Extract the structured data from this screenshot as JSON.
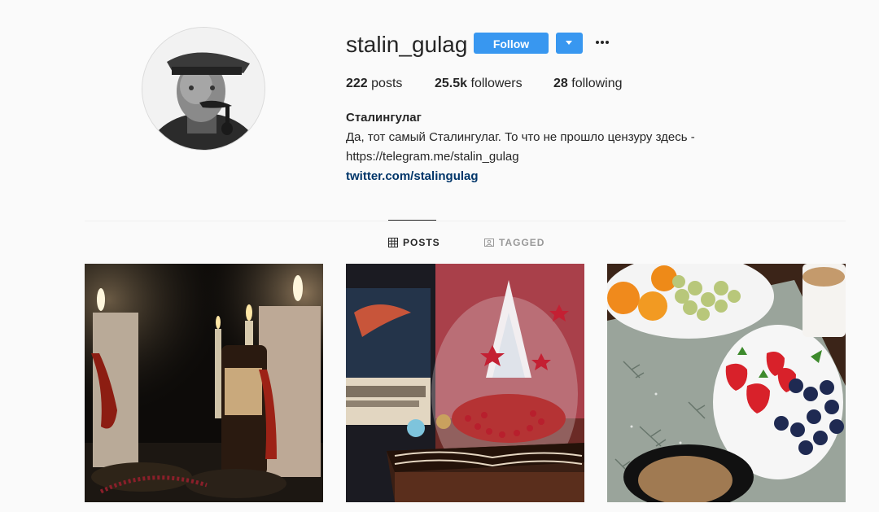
{
  "profile": {
    "username": "stalin_gulag",
    "follow_label": "Follow",
    "avatar_icon": "profile-photo",
    "stats": {
      "posts_count": "222",
      "posts_label": "posts",
      "followers_count": "25.5k",
      "followers_label": "followers",
      "following_count": "28",
      "following_label": "following"
    },
    "bio": {
      "name": "Сталингулаг",
      "line1": "Да, тот самый Сталингулаг. То что не прошло цензуру здесь -",
      "line2": "https://telegram.me/stalin_gulag",
      "link": "twitter.com/stalingulag"
    }
  },
  "tabs": [
    {
      "label": "POSTS",
      "icon": "grid-icon",
      "active": true
    },
    {
      "label": "TAGGED",
      "icon": "tag-icon",
      "active": false
    }
  ],
  "posts": [
    {
      "subject": "candles and wine bottle in dark"
    },
    {
      "subject": "wine bottle, glass ornament and chocolate cake"
    },
    {
      "subject": "fruit plates, strawberries and coffee"
    }
  ],
  "colors": {
    "accent": "#3897f0",
    "link": "#003569",
    "background": "#fafafa"
  }
}
